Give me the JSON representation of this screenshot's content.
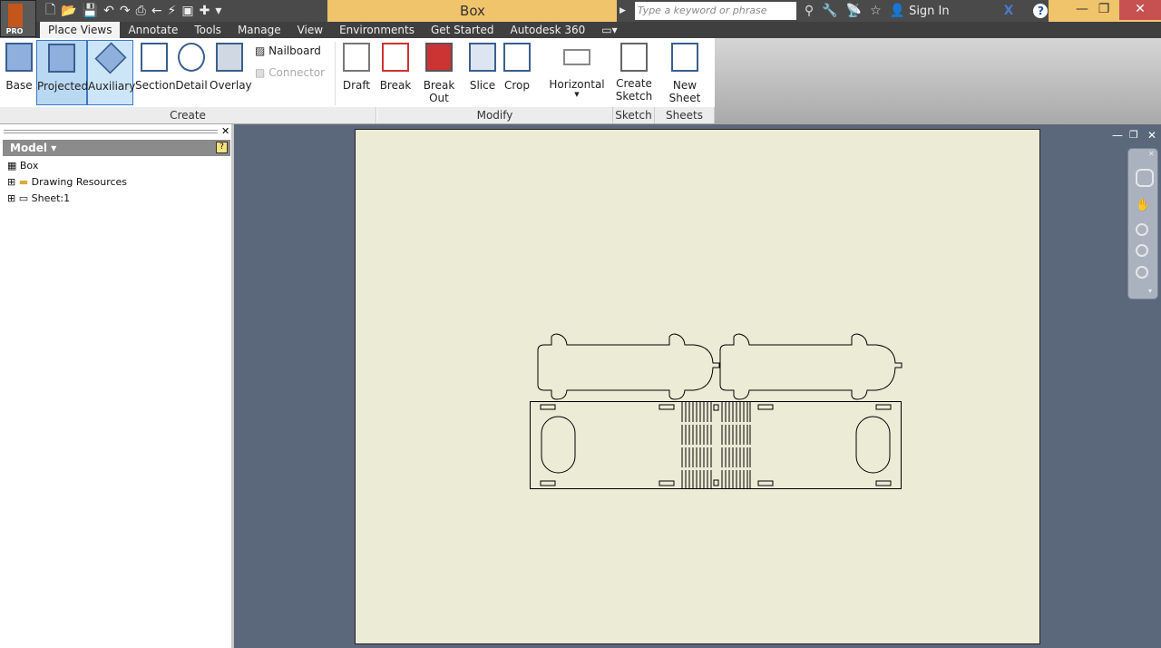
{
  "app": {
    "title": "Box",
    "badge": "PRO"
  },
  "search": {
    "placeholder": "Type a keyword or phrase"
  },
  "infobar": {
    "sign_in": "Sign In"
  },
  "tabs": [
    "Place Views",
    "Annotate",
    "Tools",
    "Manage",
    "View",
    "Environments",
    "Get Started",
    "Autodesk 360"
  ],
  "ribbon": {
    "create": {
      "label": "Create",
      "buttons": [
        "Base",
        "Projected",
        "Auxiliary",
        "Section",
        "Detail",
        "Overlay"
      ],
      "small": [
        "Nailboard",
        "Connector"
      ]
    },
    "draft": "Draft",
    "modify": {
      "label": "Modify",
      "buttons": [
        "Break",
        "Break Out",
        "Slice",
        "Crop",
        "Horizontal"
      ]
    },
    "sketch": {
      "label": "Sketch",
      "button": "Create Sketch"
    },
    "sheets": {
      "label": "Sheets",
      "button": "New Sheet"
    }
  },
  "browser": {
    "title": "Model",
    "items": [
      "Box",
      "Drawing Resources",
      "Sheet:1"
    ]
  },
  "colors": {
    "sheet": "#ebebd6",
    "canvas": "#5b687c",
    "accent": "#f0c46b"
  }
}
